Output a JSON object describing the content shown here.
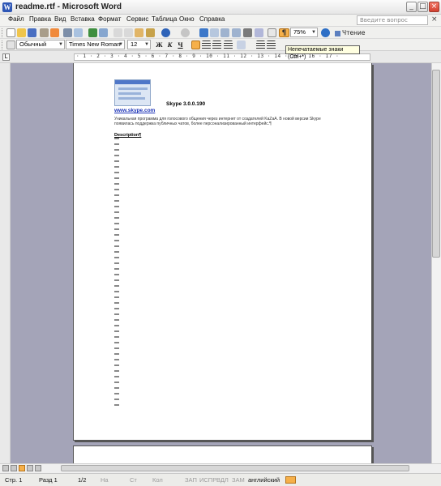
{
  "window": {
    "title": "readme.rtf - Microsoft Word",
    "icon": "word-icon"
  },
  "menu": {
    "items": [
      "Файл",
      "Правка",
      "Вид",
      "Вставка",
      "Формат",
      "Сервис",
      "Таблица",
      "Окно",
      "Справка"
    ],
    "help_placeholder": "Введите вопрос",
    "close_glyph": "×"
  },
  "toolbar": {
    "zoom": "75%",
    "reading_label": "Чтение",
    "style": "Обычный",
    "font": "Times New Roman",
    "size": "12",
    "bold": "Ж",
    "italic": "К",
    "underline": "Ч",
    "pilcrow": "¶",
    "tooltip": "Непечатаемые знаки (Ctrl+*)"
  },
  "document": {
    "link": "www.skype.com",
    "title": "Skype 3.0.0.190",
    "line1": "Уникальная программа для голосового общения через интернет от создателей KaZaA. В новой версии Skype",
    "line2": "появилась поддержка публичных чатов, более персонализированный интерфейс.¶",
    "section": "Description¶"
  },
  "status": {
    "page": "Стр. 1",
    "section": "Разд 1",
    "pages": "1/2",
    "at": "На",
    "line": "Ст",
    "col": "Кол",
    "rec": "ЗАП",
    "trk": "ИСПР",
    "ext": "ВДЛ",
    "ovr": "ЗАМ",
    "language": "английский"
  },
  "colors": {
    "workspace": "#a4a4b8",
    "accent_orange": "#f6b04a",
    "link_blue": "#1a31b6"
  }
}
